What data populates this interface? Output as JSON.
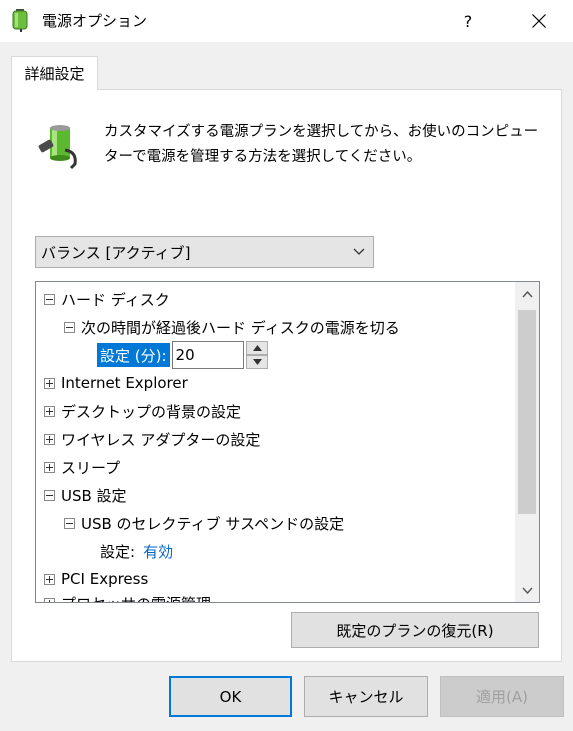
{
  "window": {
    "title": "電源オプション",
    "help": "?",
    "icon": "power-battery-icon"
  },
  "tab": {
    "label": "詳細設定"
  },
  "description": "カスタマイズする電源プランを選択してから、お使いのコンピューターで電源を管理する方法を選択してください。",
  "plan_select": {
    "value": "バランス [アクティブ]"
  },
  "tree": {
    "hard_disk": "ハード ディスク",
    "turn_off_disk": "次の時間が経過後ハード ディスクの電源を切る",
    "setting_minutes_label": "設定 (分):",
    "setting_minutes_value": "20",
    "internet_explorer": "Internet Explorer",
    "desktop_background": "デスクトップの背景の設定",
    "wireless_adapter": "ワイヤレス アダプターの設定",
    "sleep": "スリープ",
    "usb_settings": "USB 設定",
    "usb_selective_suspend": "USB のセレクティブ サスペンドの設定",
    "setting_label": "設定:",
    "setting_value": "有効",
    "pci_express": "PCI Express",
    "processor_power": "プロセッサの電源管理"
  },
  "buttons": {
    "restore": "既定のプランの復元(R)",
    "ok": "OK",
    "cancel": "キャンセル",
    "apply": "適用(A)"
  },
  "colors": {
    "selection": "#0078d7",
    "link": "#0066cc"
  }
}
